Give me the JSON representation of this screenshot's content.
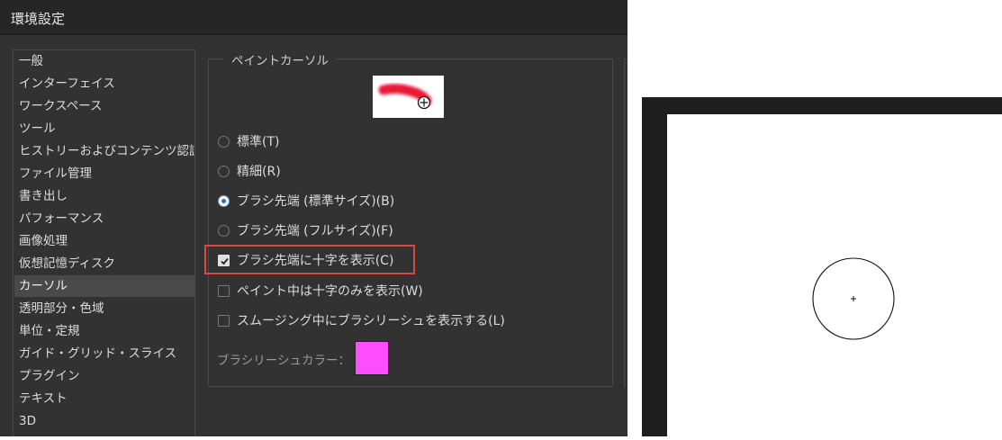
{
  "window": {
    "title": "環境設定"
  },
  "sidebar": {
    "items": [
      {
        "label": "一般"
      },
      {
        "label": "インターフェイス"
      },
      {
        "label": "ワークスペース"
      },
      {
        "label": "ツール"
      },
      {
        "label": "ヒストリーおよびコンテンツ認証..."
      },
      {
        "label": "ファイル管理"
      },
      {
        "label": "書き出し"
      },
      {
        "label": "パフォーマンス"
      },
      {
        "label": "画像処理"
      },
      {
        "label": "仮想記憶ディスク"
      },
      {
        "label": "カーソル"
      },
      {
        "label": "透明部分・色域"
      },
      {
        "label": "単位・定規"
      },
      {
        "label": "ガイド・グリッド・スライス"
      },
      {
        "label": "プラグイン"
      },
      {
        "label": "テキスト"
      },
      {
        "label": "3D"
      }
    ],
    "selected": "カーソル"
  },
  "paint_cursor": {
    "legend": "ペイントカーソル",
    "options": [
      {
        "label": "標準(T)",
        "checked": false
      },
      {
        "label": "精細(R)",
        "checked": false
      },
      {
        "label": "ブラシ先端 (標準サイズ)(B)",
        "checked": true
      },
      {
        "label": "ブラシ先端 (フルサイズ)(F)",
        "checked": false
      }
    ],
    "checkboxes": [
      {
        "label": "ブラシ先端に十字を表示(C)",
        "checked": true
      },
      {
        "label": "ペイント中は十字のみを表示(W)",
        "checked": false
      },
      {
        "label": "スムージング中にブラシリーシュを表示する(L)",
        "checked": false
      }
    ],
    "leash_color_label": "ブラシリーシュカラー：",
    "leash_color": "#ff4cff"
  },
  "colors": {
    "dialog_bg": "#323232",
    "highlight": "#e04545",
    "brush_preview_stroke": "#e8102e"
  }
}
